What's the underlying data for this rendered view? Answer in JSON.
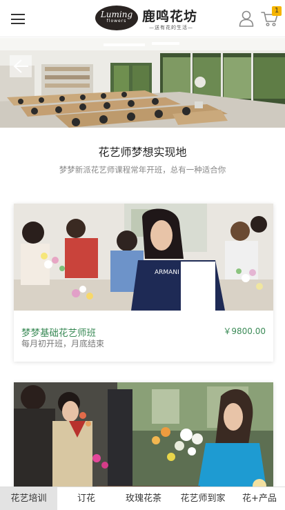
{
  "header": {
    "logo_script": "Luming",
    "logo_sub": "flowers",
    "logo_name": "鹿鸣花坊",
    "logo_slogan": "—送有花的生活—",
    "cart_count": "1",
    "icons": [
      "menu-icon",
      "user-icon",
      "cart-icon"
    ]
  },
  "banner": {
    "prev_icon": "arrow-left-icon"
  },
  "section": {
    "title": "花艺师梦想实现地",
    "subtitle": "梦梦新派花艺师课程常年开班，总有一种适合你"
  },
  "courses": [
    {
      "name": "梦梦基础花艺师班",
      "price": "￥9800.00",
      "desc": "每月初开班，月底结束",
      "shirt_text": "ARMANI"
    }
  ],
  "bottom_nav": {
    "items": [
      {
        "label": "花艺培训",
        "active": true
      },
      {
        "label": "订花",
        "active": false
      },
      {
        "label": "玫瑰花茶",
        "active": false
      },
      {
        "label": "花艺师到家",
        "active": false
      },
      {
        "label": "花+产品",
        "active": false
      }
    ]
  },
  "colors": {
    "accent_green": "#3a8a56",
    "badge_yellow": "#f5b400",
    "nav_active_bg": "#e3e3e3"
  }
}
